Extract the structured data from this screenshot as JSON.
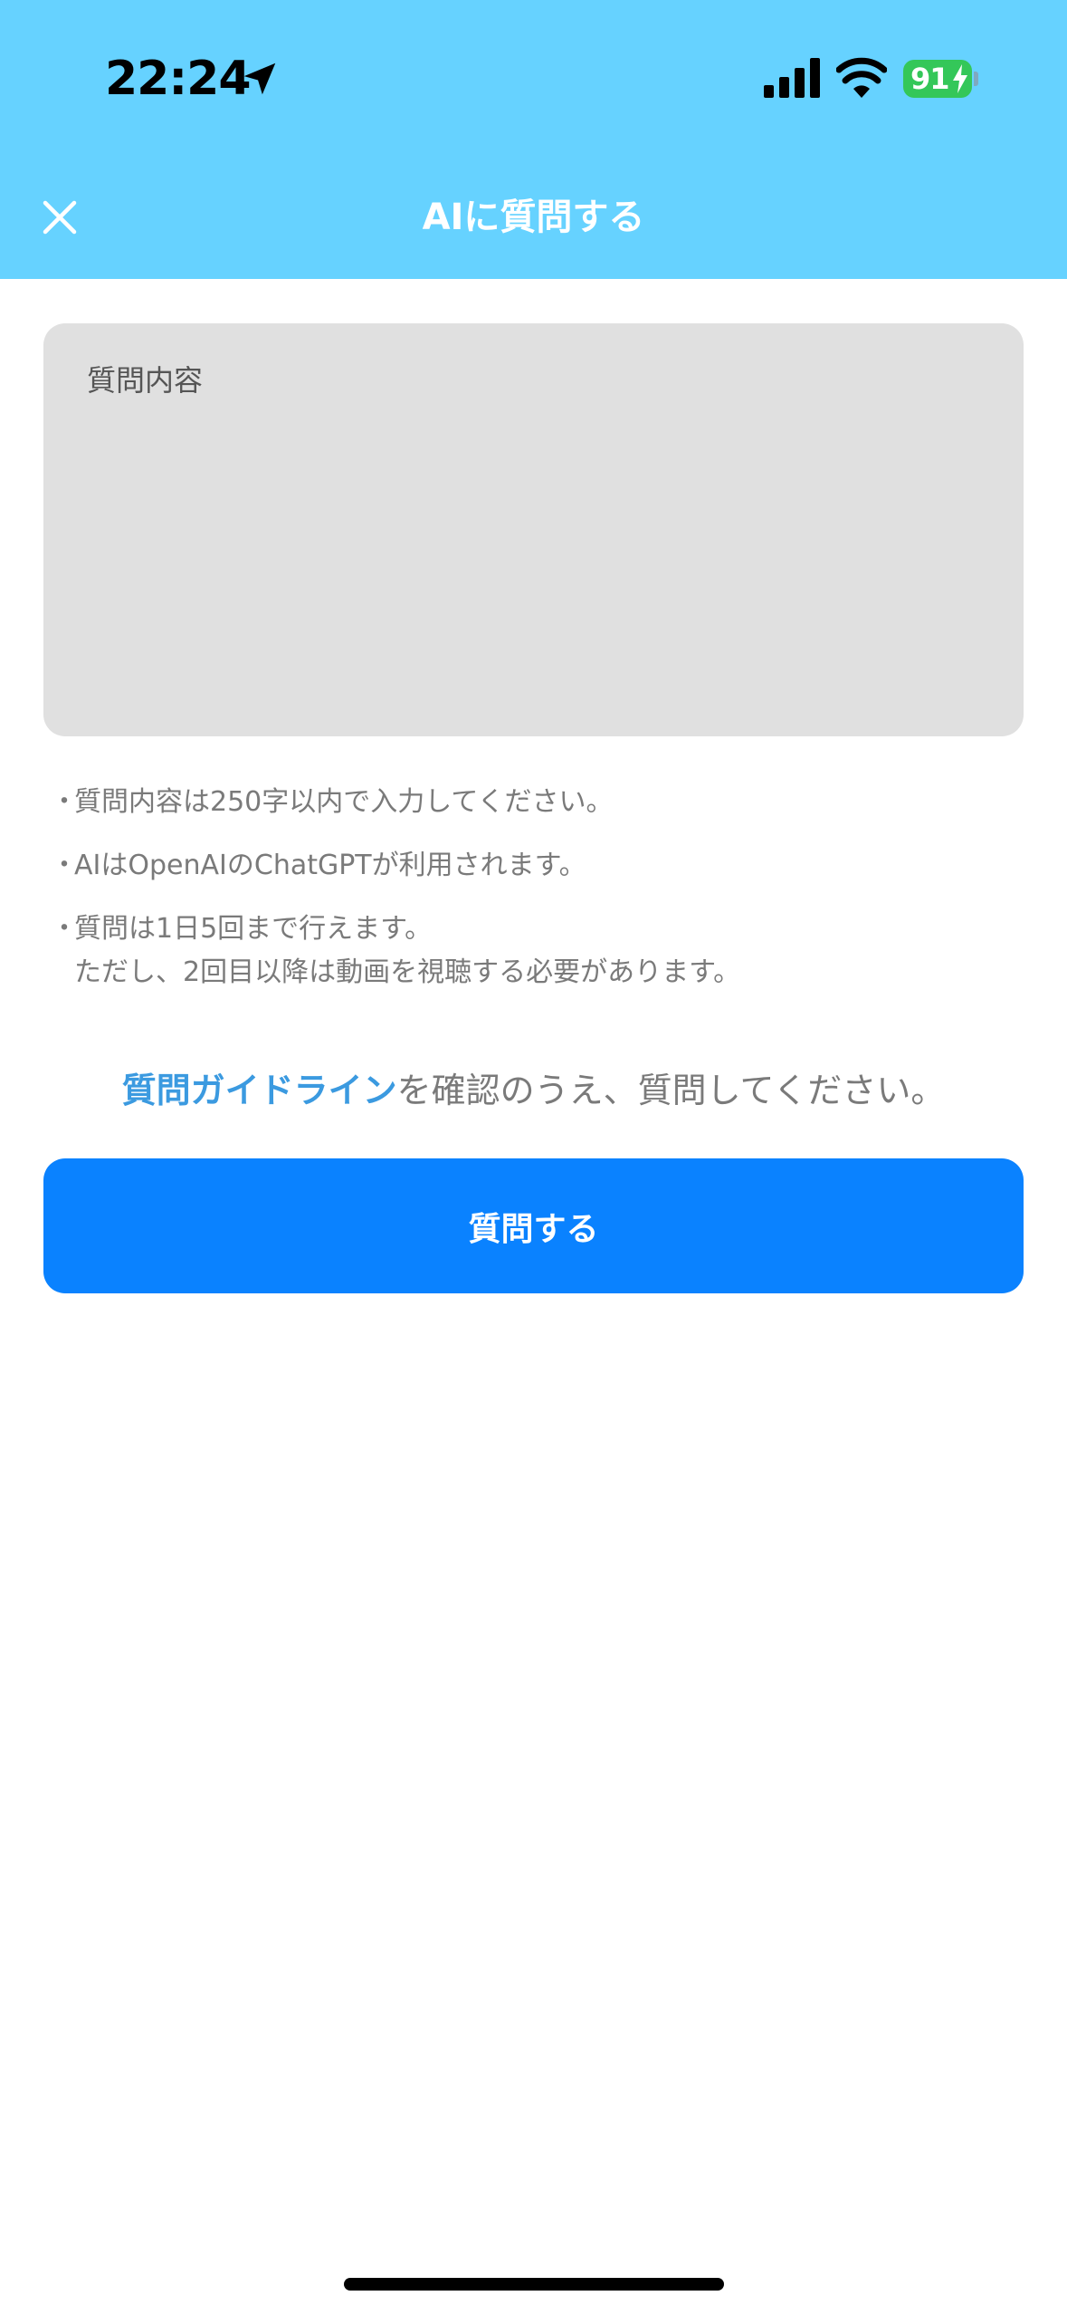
{
  "status_bar": {
    "time": "22:24",
    "battery_level": "91",
    "icons": [
      "location-arrow-icon",
      "cellular-signal-icon",
      "wifi-icon",
      "battery-charging-icon"
    ]
  },
  "nav": {
    "title": "AIに質問する",
    "close_icon": "close-icon",
    "background_color": "#66d2ff"
  },
  "question": {
    "placeholder": "質問内容",
    "value": ""
  },
  "notes": [
    "質問内容は250字以内で入力してください。",
    "AIはOpenAIのChatGPTが利用されます。",
    "質問は1日5回まで行えます。\nただし、2回目以降は動画を視聴する必要があります。"
  ],
  "note_bullet": "・",
  "guideline": {
    "link_text": "質問ガイドライン",
    "rest_text": "を確認のうえ、質問してください。",
    "link_color": "#3b9ae0"
  },
  "submit": {
    "label": "質問する",
    "color": "#0a82ff"
  }
}
